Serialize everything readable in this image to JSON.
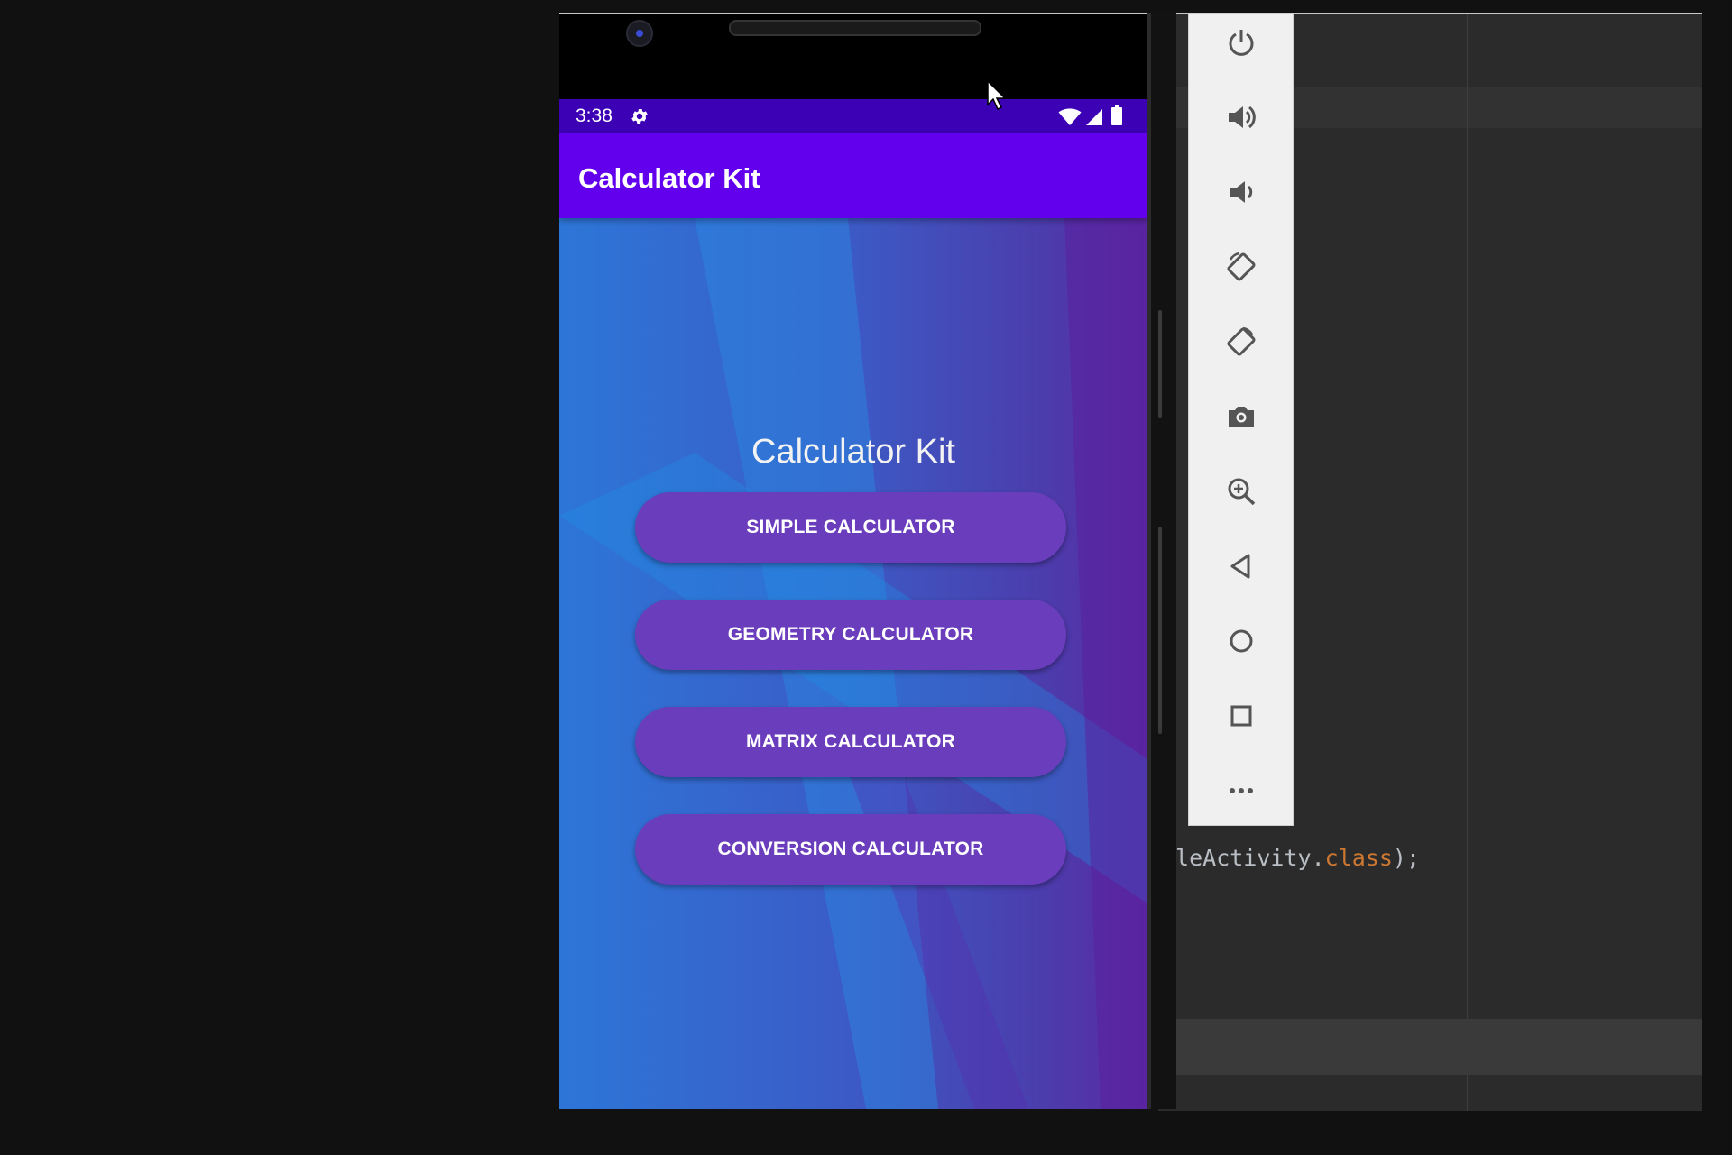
{
  "ide": {
    "code_snippet": {
      "prefix": "gleActivity.",
      "keyword": "class",
      "suffix": ");"
    }
  },
  "status_bar": {
    "time": "3:38"
  },
  "app_bar": {
    "title": "Calculator Kit"
  },
  "main": {
    "heading": "Calculator Kit",
    "buttons": [
      {
        "label": "SIMPLE CALCULATOR"
      },
      {
        "label": "GEOMETRY CALCULATOR"
      },
      {
        "label": "MATRIX CALCULATOR"
      },
      {
        "label": "CONVERSION CALCULATOR"
      }
    ]
  },
  "emulator_toolbar": {
    "tools": [
      "power-icon",
      "volume-up-icon",
      "volume-down-icon",
      "rotate-left-icon",
      "rotate-right-icon",
      "camera-icon",
      "zoom-icon",
      "back-icon",
      "home-icon",
      "overview-icon",
      "more-icon"
    ]
  },
  "colors": {
    "status_bar": "#3c00b5",
    "app_bar": "#6200ee",
    "button": "#6a3dbc",
    "toolbar": "#f0f0f0"
  }
}
